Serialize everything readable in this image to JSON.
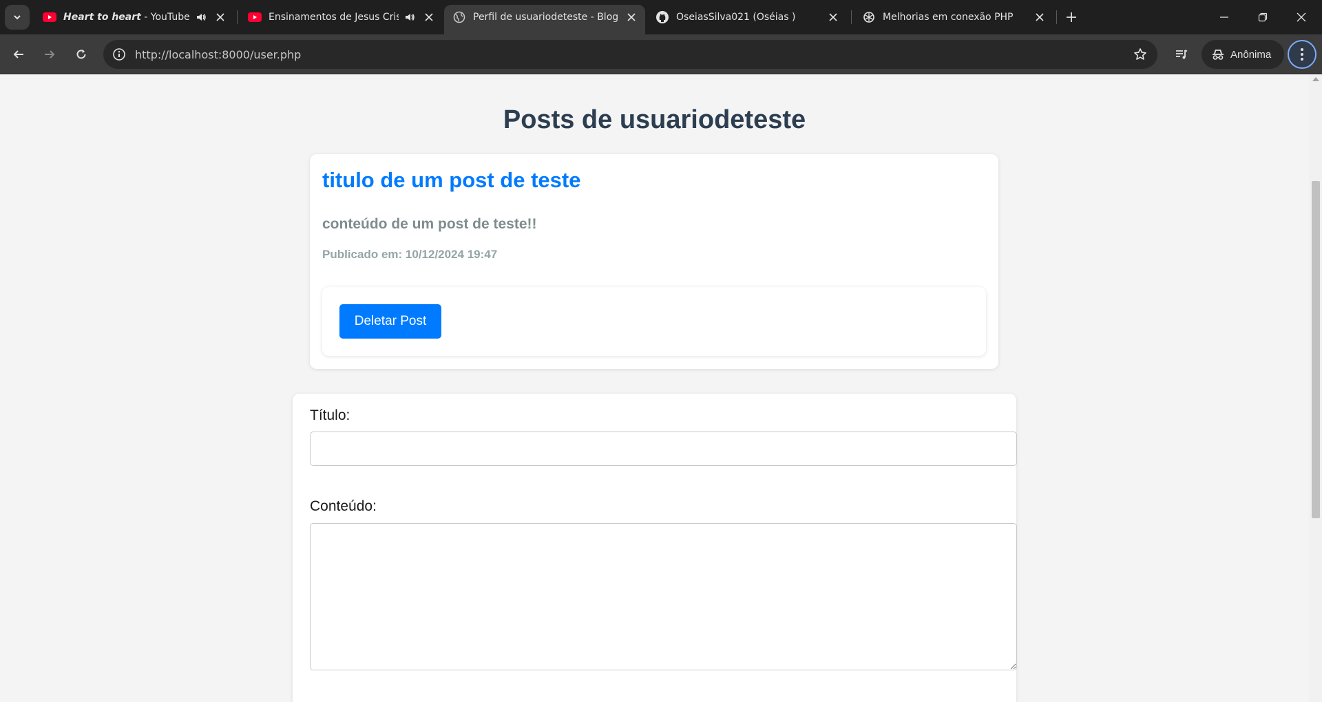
{
  "browser": {
    "tabs": [
      {
        "title_bold": "Heart to heart",
        "title_rest": " - YouTube",
        "favicon": "youtube-icon",
        "audio": true
      },
      {
        "title_bold": "",
        "title_rest": "Ensinamentos de Jesus Cristo",
        "favicon": "youtube-icon",
        "audio": true
      },
      {
        "title_bold": "",
        "title_rest": "Perfil de usuariodeteste - Blog PHP",
        "favicon": "globe-icon",
        "audio": false,
        "active": true
      },
      {
        "title_bold": "",
        "title_rest": "OseiasSilva021 (Oséias )",
        "favicon": "github-icon",
        "audio": false
      },
      {
        "title_bold": "",
        "title_rest": "Melhorias em conexão PHP",
        "favicon": "chatgpt-icon",
        "audio": false
      }
    ],
    "url": "http://localhost:8000/user.php",
    "profile_label": "Anônima",
    "colors": {
      "chrome_dark": "#1f1f1f",
      "toolbar": "#3c3c3c",
      "accent": "#7cacf8"
    }
  },
  "page": {
    "heading": "Posts de usuariodeteste",
    "post": {
      "title": "titulo de um post de teste",
      "content": "conteúdo de um post de teste!!",
      "published": "Publicado em: 10/12/2024 19:47",
      "delete_label": "Deletar Post"
    },
    "form": {
      "title_label": "Título:",
      "title_value": "",
      "content_label": "Conteúdo:",
      "content_value": ""
    },
    "colors": {
      "link": "#007bff",
      "heading": "#2c3e50",
      "muted": "#7f8c8d",
      "background": "#f4f4f4"
    }
  }
}
